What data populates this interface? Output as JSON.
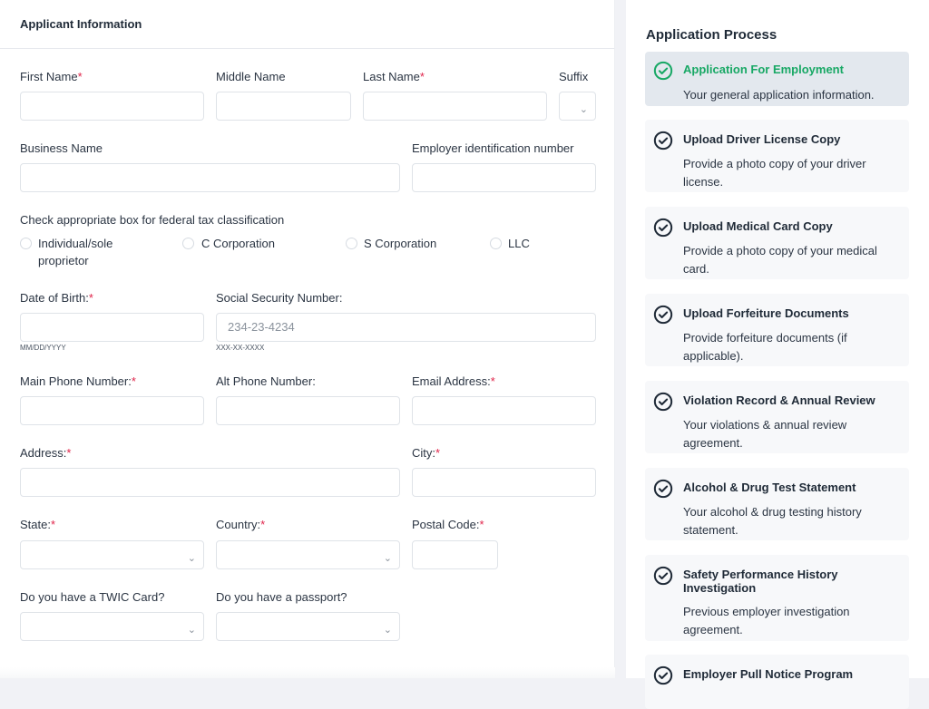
{
  "form": {
    "section_title": "Applicant Information",
    "required_marker": "*",
    "fields": {
      "first_name": {
        "label": "First Name",
        "value": ""
      },
      "middle_name": {
        "label": "Middle Name",
        "value": ""
      },
      "last_name": {
        "label": "Last Name",
        "value": ""
      },
      "suffix": {
        "label": "Suffix",
        "value": ""
      },
      "business_name": {
        "label": "Business Name",
        "value": ""
      },
      "ein": {
        "label": "Employer identification number",
        "value": ""
      },
      "dob": {
        "label": "Date of Birth:",
        "value": "",
        "hint": "MM/DD/YYYY"
      },
      "ssn": {
        "label": "Social Security Number:",
        "value": "",
        "placeholder": "234-23-4234",
        "hint": "XXX-XX-XXXX"
      },
      "main_phone": {
        "label": "Main Phone Number:",
        "value": ""
      },
      "alt_phone": {
        "label": "Alt Phone Number:",
        "value": ""
      },
      "email": {
        "label": "Email Address:",
        "value": ""
      },
      "address": {
        "label": "Address:",
        "value": ""
      },
      "city": {
        "label": "City:",
        "value": ""
      },
      "state": {
        "label": "State:",
        "value": ""
      },
      "country": {
        "label": "Country:",
        "value": ""
      },
      "postal_code": {
        "label": "Postal Code:",
        "value": ""
      },
      "twic": {
        "label": "Do you have a TWIC Card?",
        "value": ""
      },
      "passport": {
        "label": "Do you have a passport?",
        "value": ""
      }
    },
    "tax_classification": {
      "label": "Check appropriate box for federal tax classification",
      "options": [
        {
          "line1": "Individual/sole",
          "line2": "proprietor",
          "checked": false
        },
        {
          "line1": "C Corporation",
          "line2": "",
          "checked": false
        },
        {
          "line1": "S Corporation",
          "line2": "",
          "checked": false
        },
        {
          "line1": "LLC",
          "line2": "",
          "checked": false
        }
      ]
    }
  },
  "process": {
    "title": "Application Process",
    "colors": {
      "active": "#18a865",
      "inactive": "#1f2a37"
    },
    "steps": [
      {
        "title": "Application For Employment",
        "description": "Your general application information.",
        "active": true
      },
      {
        "title": "Upload Driver License Copy",
        "description": "Provide a photo copy of your driver license.",
        "active": false
      },
      {
        "title": "Upload Medical Card Copy",
        "description": "Provide a photo copy of your medical card.",
        "active": false
      },
      {
        "title": "Upload Forfeiture Documents",
        "description": "Provide forfeiture documents (if applicable).",
        "active": false
      },
      {
        "title": "Violation Record & Annual Review",
        "description": "Your violations & annual review agreement.",
        "active": false
      },
      {
        "title": "Alcohol & Drug Test Statement",
        "description": "Your alcohol & drug testing history statement.",
        "active": false
      },
      {
        "title": "Safety Performance History Investigation",
        "description": "Previous employer investigation agreement.",
        "active": false
      },
      {
        "title": "Employer Pull Notice Program",
        "description": "",
        "active": false
      }
    ]
  }
}
